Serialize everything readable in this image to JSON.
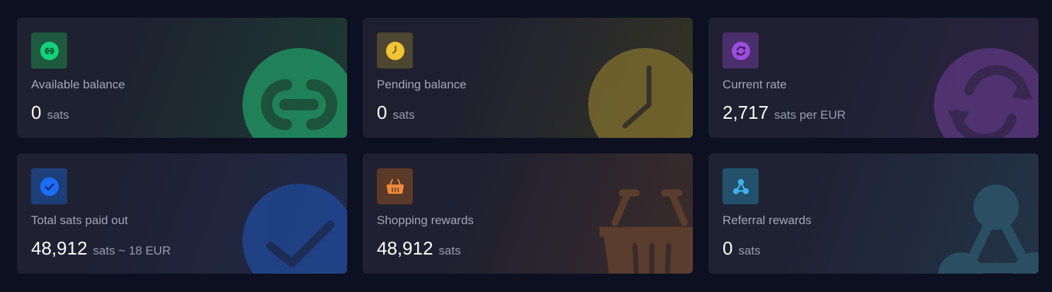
{
  "cards": [
    {
      "label": "Available balance",
      "value": "0",
      "unit": "sats",
      "icon": "link-icon",
      "color": "#12d37a"
    },
    {
      "label": "Pending balance",
      "value": "0",
      "unit": "sats",
      "icon": "clock-icon",
      "color": "#f1c232"
    },
    {
      "label": "Current rate",
      "value": "2,717",
      "unit": "sats per EUR",
      "icon": "refresh-icon",
      "color": "#9b4ddb"
    },
    {
      "label": "Total sats paid out",
      "value": "48,912",
      "unit": "sats ~ 18 EUR",
      "icon": "check-icon",
      "color": "#1b6dff"
    },
    {
      "label": "Shopping rewards",
      "value": "48,912",
      "unit": "sats",
      "icon": "basket-icon",
      "color": "#f08a3c"
    },
    {
      "label": "Referral rewards",
      "value": "0",
      "unit": "sats",
      "icon": "network-icon",
      "color": "#3fb1e8"
    }
  ]
}
